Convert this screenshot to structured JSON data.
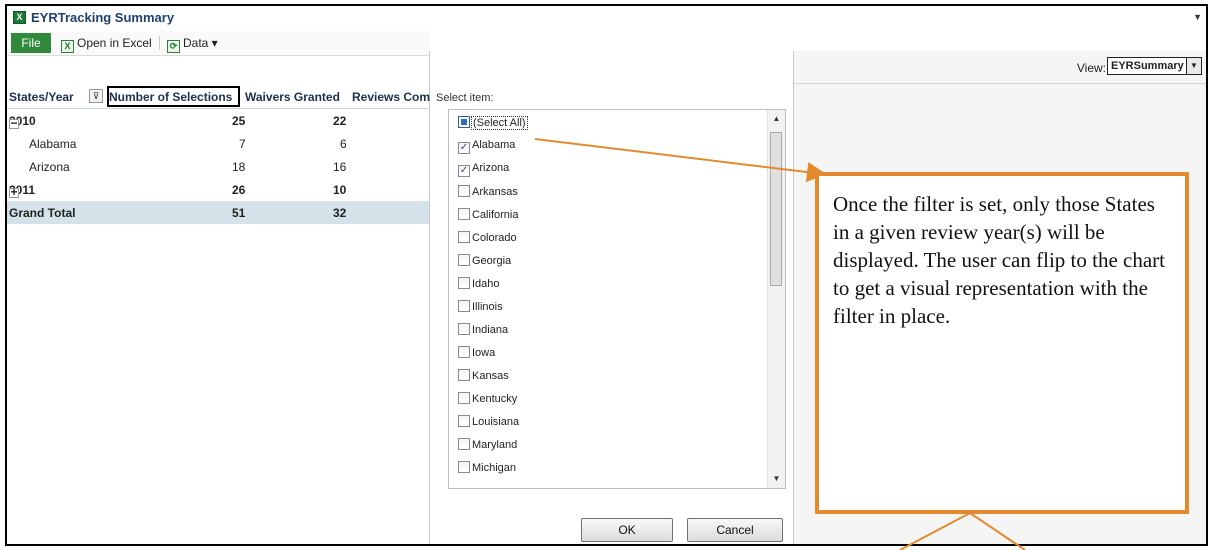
{
  "window": {
    "title": "EYRTracking Summary"
  },
  "toolbar": {
    "file_label": "File",
    "open_excel_label": "Open in Excel",
    "data_label": "Data ▾"
  },
  "pivot": {
    "headers": {
      "states_year": "States/Year",
      "number_of_selections": "Number of Selections",
      "waivers_granted": "Waivers Granted",
      "reviews_completed": "Reviews Comp"
    },
    "rows": [
      {
        "label": "2010",
        "expander": "−",
        "selections": "25",
        "waivers": "22"
      },
      {
        "label": "Alabama",
        "selections": "7",
        "waivers": "6"
      },
      {
        "label": "Arizona",
        "selections": "18",
        "waivers": "16"
      },
      {
        "label": "2011",
        "expander": "+",
        "selections": "26",
        "waivers": "10"
      },
      {
        "label": "Grand Total",
        "selections": "51",
        "waivers": "32"
      }
    ]
  },
  "filter": {
    "label": "Select item:",
    "items": [
      {
        "label": "(Select All)",
        "state": "partial"
      },
      {
        "label": "Alabama",
        "state": "checked"
      },
      {
        "label": "Arizona",
        "state": "checked"
      },
      {
        "label": "Arkansas",
        "state": "unchecked"
      },
      {
        "label": "California",
        "state": "unchecked"
      },
      {
        "label": "Colorado",
        "state": "unchecked"
      },
      {
        "label": "Georgia",
        "state": "unchecked"
      },
      {
        "label": "Idaho",
        "state": "unchecked"
      },
      {
        "label": "Illinois",
        "state": "unchecked"
      },
      {
        "label": "Indiana",
        "state": "unchecked"
      },
      {
        "label": "Iowa",
        "state": "unchecked"
      },
      {
        "label": "Kansas",
        "state": "unchecked"
      },
      {
        "label": "Kentucky",
        "state": "unchecked"
      },
      {
        "label": "Louisiana",
        "state": "unchecked"
      },
      {
        "label": "Maryland",
        "state": "unchecked"
      },
      {
        "label": "Michigan",
        "state": "unchecked"
      }
    ],
    "ok_label": "OK",
    "cancel_label": "Cancel"
  },
  "view": {
    "label": "View:",
    "selected": "EYRSummary"
  },
  "callout": {
    "text": "Once the filter is set, only those States in a given review year(s) will be displayed.  The user can flip to the chart to get a visual representation with the filter in place."
  },
  "colors": {
    "callout_border": "#e48a2e",
    "file_button": "#2f8a3b",
    "total_row": "#d4e3ea"
  },
  "icons": {
    "excel": "excel-icon",
    "data": "data-refresh-icon",
    "filter": "filter-icon"
  }
}
